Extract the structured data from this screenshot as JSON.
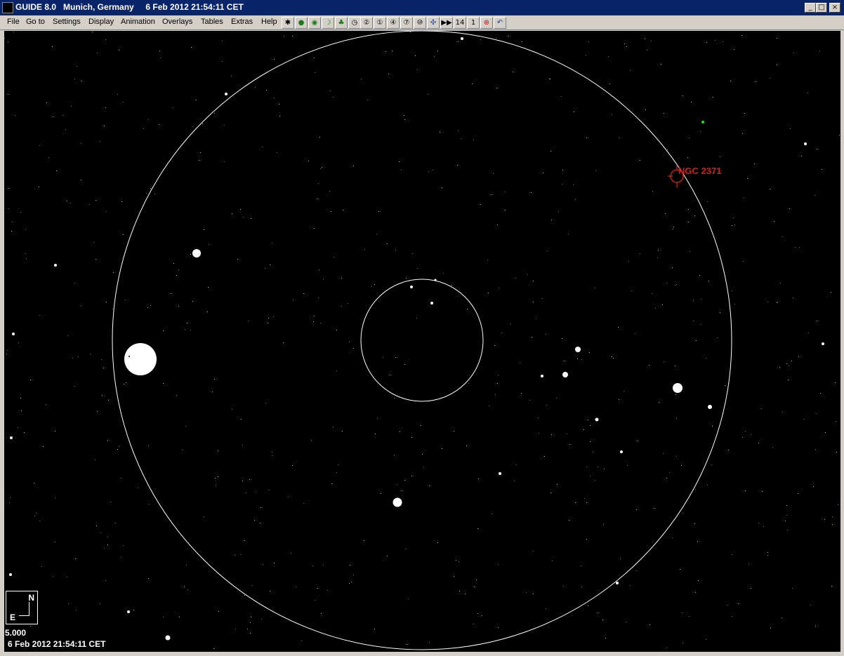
{
  "window": {
    "title": "GUIDE 8.0   Munich, Germany     6 Feb 2012 21:54:11 CET",
    "minimize_glyph": "_",
    "maximize_glyph": "□",
    "close_glyph": "×"
  },
  "menu": {
    "items": [
      "File",
      "Go to",
      "Settings",
      "Display",
      "Animation",
      "Overlays",
      "Tables",
      "Extras",
      "Help"
    ]
  },
  "toolbar": {
    "buttons": [
      {
        "name": "telescope-icon",
        "glyph": "✱"
      },
      {
        "name": "planet-icon",
        "glyph": "●"
      },
      {
        "name": "target-icon",
        "glyph": "◉"
      },
      {
        "name": "moon-icon",
        "glyph": "☽"
      },
      {
        "name": "tree-icon",
        "glyph": "♣"
      },
      {
        "name": "clock-icon",
        "glyph": "◷"
      },
      {
        "name": "level-2-icon",
        "glyph": "②"
      },
      {
        "name": "level-1-icon",
        "glyph": "①"
      },
      {
        "name": "level-4-icon",
        "glyph": "④"
      },
      {
        "name": "level-7-icon",
        "glyph": "⑦"
      },
      {
        "name": "level-10-icon",
        "glyph": "⑩"
      },
      {
        "name": "star-field-icon",
        "glyph": "✣"
      },
      {
        "name": "fast-forward-icon",
        "glyph": "▶▶"
      },
      {
        "name": "step-14-icon",
        "glyph": "14"
      },
      {
        "name": "step-1-icon",
        "glyph": "1"
      },
      {
        "name": "crosshair-icon",
        "glyph": "⊕"
      },
      {
        "name": "undo-icon",
        "glyph": "↶"
      }
    ]
  },
  "chart": {
    "object_label": "NGC 2371",
    "compass_north": "N",
    "compass_east": "E",
    "scale": "5.000",
    "datetime": "6 Feb 2012 21:54:11 CET",
    "colors": {
      "sky": "#000000",
      "circle": "#ffffff",
      "object": "#dd1a1a",
      "green_star": "#22dd22"
    }
  }
}
